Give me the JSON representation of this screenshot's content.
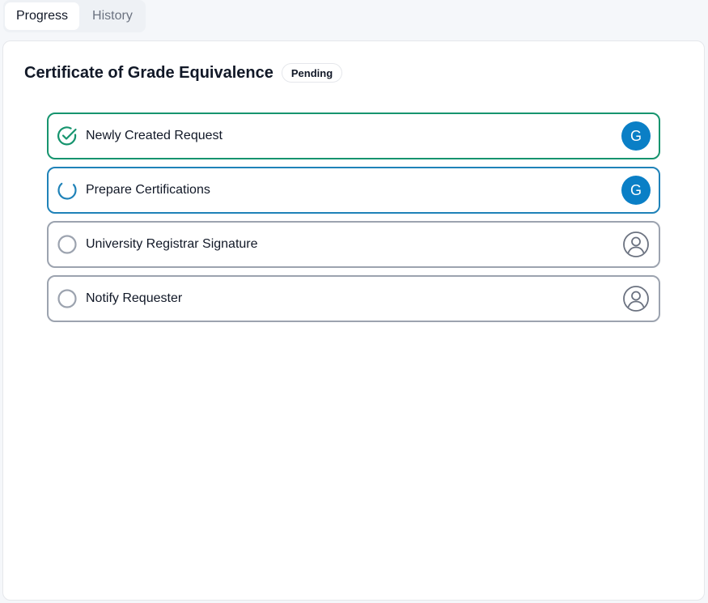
{
  "tabs": [
    {
      "label": "Progress",
      "active": true
    },
    {
      "label": "History",
      "active": false
    }
  ],
  "request": {
    "title": "Certificate of Grade Equivalence",
    "status": "Pending"
  },
  "steps": [
    {
      "label": "Newly Created Request",
      "state": "done",
      "assignee_initial": "G",
      "icon": "check-circle-icon"
    },
    {
      "label": "Prepare Certifications",
      "state": "in-progress",
      "assignee_initial": "G",
      "icon": "spinner-icon"
    },
    {
      "label": "University Registrar Signature",
      "state": "pending",
      "assignee_initial": null,
      "icon": "empty-circle-icon"
    },
    {
      "label": "Notify Requester",
      "state": "pending",
      "assignee_initial": null,
      "icon": "empty-circle-icon"
    }
  ],
  "colors": {
    "done": "#16946e",
    "in_progress": "#1f82b8",
    "pending": "#9ca3af",
    "avatar": "#0a7fc6"
  }
}
